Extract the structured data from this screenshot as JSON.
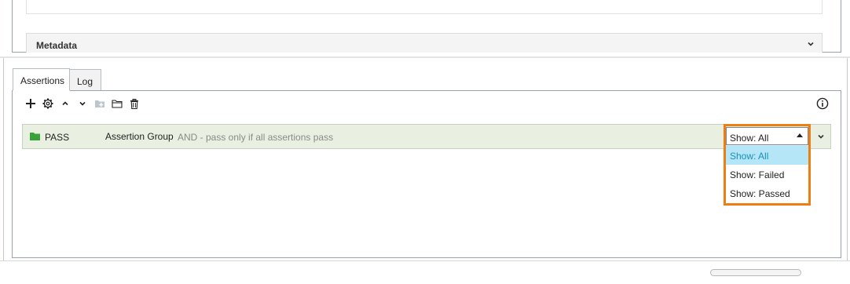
{
  "metadata": {
    "title": "Metadata"
  },
  "tabs": [
    {
      "label": "Assertions",
      "active": true
    },
    {
      "label": "Log",
      "active": false
    }
  ],
  "toolbar": {
    "icons": [
      "plus-icon",
      "gear-icon",
      "chevron-up-icon",
      "chevron-down-icon",
      "folder-add-icon",
      "folder-icon",
      "trash-icon"
    ],
    "info_icon": "info-icon"
  },
  "assertion_row": {
    "status": "PASS",
    "type": "Assertion Group",
    "description": "AND - pass only if all assertions pass",
    "status_color": "#3aa23a"
  },
  "filter": {
    "value": "Show: All",
    "options": [
      "Show: All",
      "Show: Failed",
      "Show: Passed"
    ],
    "selected_index": 0,
    "highlight_color": "#ee7d14"
  }
}
